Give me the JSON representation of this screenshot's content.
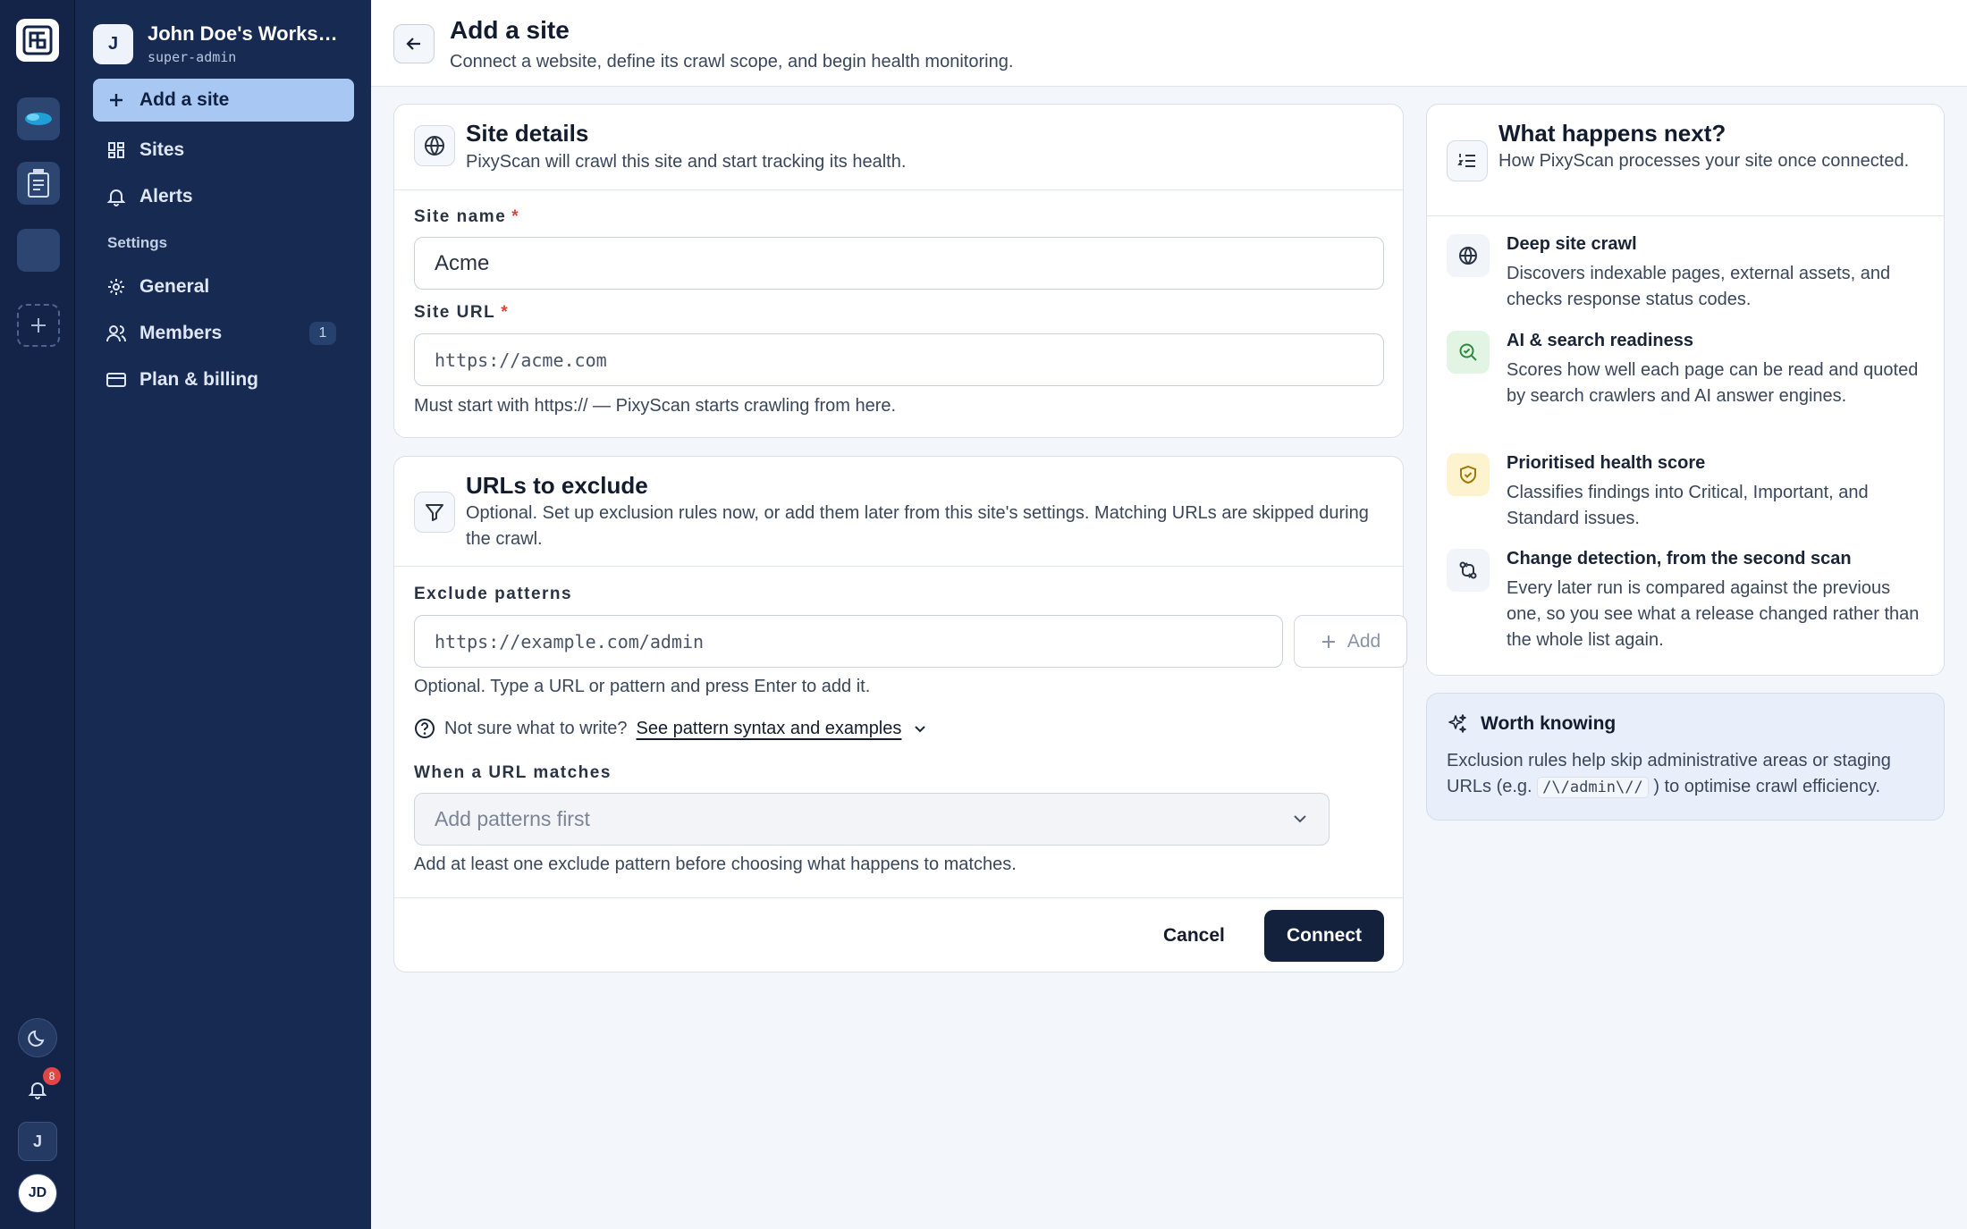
{
  "workspace": {
    "initial": "J",
    "name": "John Doe's Workspace",
    "role": "super-admin"
  },
  "rail": {
    "notification_count": "8",
    "workspace_initial": "J",
    "user_initials": "JD"
  },
  "nav": {
    "add_site": "Add a site",
    "sites": "Sites",
    "alerts": "Alerts",
    "settings_label": "Settings",
    "general": "General",
    "members": "Members",
    "members_count": "1",
    "plan_billing": "Plan & billing"
  },
  "header": {
    "title": "Add a site",
    "subtitle": "Connect a website, define its crawl scope, and begin health monitoring."
  },
  "site_details": {
    "title": "Site details",
    "description": "PixyScan will crawl this site and start tracking its health.",
    "name_label": "Site name",
    "name_value": "Acme",
    "url_label": "Site URL",
    "url_placeholder": "https://acme.com",
    "url_helper": "Must start with https:// — PixyScan starts crawling from here."
  },
  "exclude": {
    "title": "URLs to exclude",
    "description": "Optional. Set up exclusion rules now, or add them later from this site's settings. Matching URLs are skipped during the crawl.",
    "patterns_label": "Exclude patterns",
    "pattern_placeholder": "https://example.com/admin",
    "add_label": "Add",
    "pattern_helper": "Optional. Type a URL or pattern and press Enter to add it.",
    "unsure_text": "Not sure what to write?",
    "syntax_link": "See pattern syntax and examples",
    "match_label": "When a URL matches",
    "match_select": "Add patterns first",
    "match_helper": "Add at least one exclude pattern before choosing what happens to matches.",
    "cancel": "Cancel",
    "connect": "Connect"
  },
  "next": {
    "title": "What happens next?",
    "subtitle": "How PixyScan processes your site once connected.",
    "items": [
      {
        "title": "Deep site crawl",
        "desc": "Discovers indexable pages, external assets, and checks response status codes."
      },
      {
        "title": "AI & search readiness",
        "desc": "Scores how well each page can be read and quoted by search crawlers and AI answer engines."
      },
      {
        "title": "Prioritised health score",
        "desc": "Classifies findings into Critical, Important, and Standard issues."
      },
      {
        "title": "Change detection, from the second scan",
        "desc": "Every later run is compared against the previous one, so you see what a release changed rather than the whole list again."
      }
    ]
  },
  "worth": {
    "title": "Worth knowing",
    "text_before": "Exclusion rules help skip administrative areas or staging URLs (e.g.",
    "code": "/\\/admin\\//",
    "text_after": ") to optimise crawl efficiency."
  }
}
